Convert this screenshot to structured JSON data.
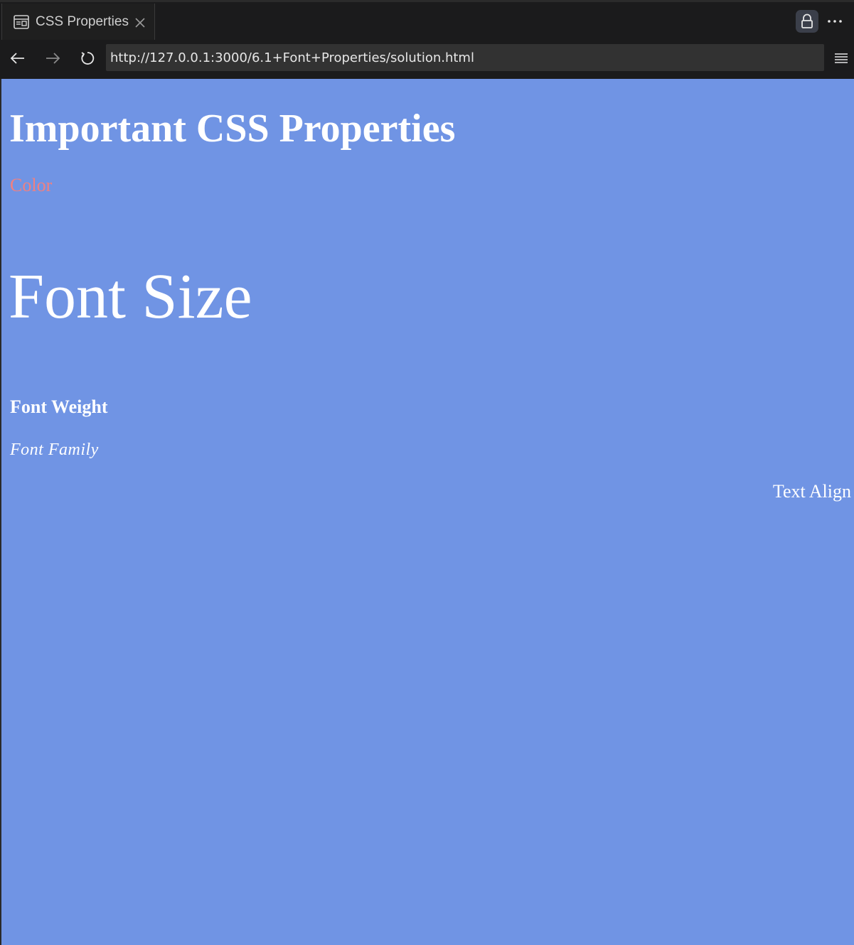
{
  "tab": {
    "title": "CSS Properties",
    "icon": "browser-page-icon"
  },
  "toolbar": {
    "url": "http://127.0.0.1:3000/6.1+Font+Properties/solution.html"
  },
  "page": {
    "heading": "Important CSS Properties",
    "color_text": "Color",
    "font_size_text": "Font Size",
    "font_weight_text": "Font Weight",
    "font_family_text": "Font Family",
    "text_align_text": "Text Align",
    "background_color": "#7094e4",
    "color_accent": "#f08080"
  }
}
